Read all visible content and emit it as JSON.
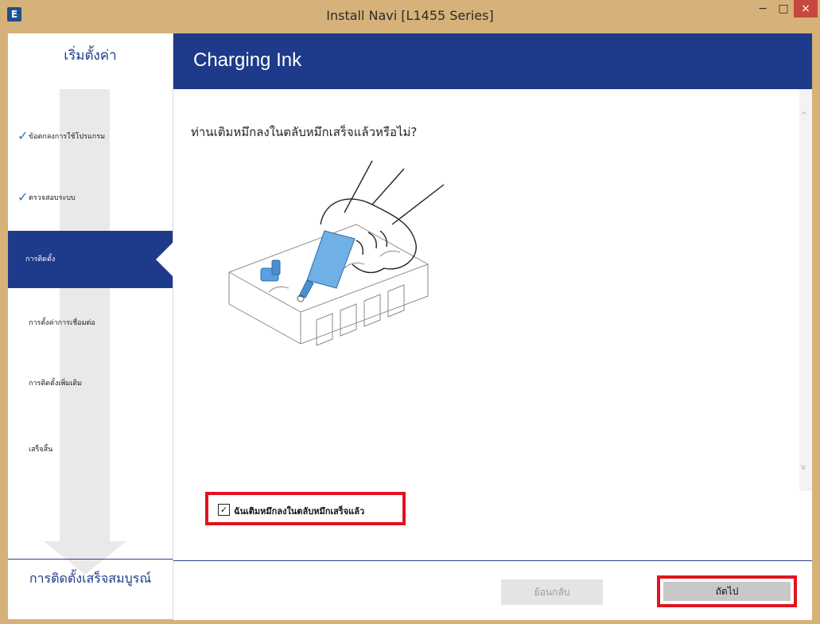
{
  "window": {
    "app_icon_letter": "E",
    "title": "Install Navi [L1455 Series]",
    "minimize_glyph": "−",
    "maximize_glyph": "□",
    "close_glyph": "×"
  },
  "sidebar": {
    "header": "เริ่มตั้งค่า",
    "steps": [
      {
        "label": "ข้อตกลงการใช้โปรแกรม",
        "state": "done",
        "check": "✓"
      },
      {
        "label": "ตรวจสอบระบบ",
        "state": "done",
        "check": "✓"
      },
      {
        "label": "การติดตั้ง",
        "state": "current"
      },
      {
        "label": "การตั้งค่าการเชื่อมต่อ",
        "state": "pending"
      },
      {
        "label": "การติดตั้งเพิ่มเติม",
        "state": "pending"
      },
      {
        "label": "เสร็จสิ้น",
        "state": "pending"
      }
    ],
    "footer": "การติดตั้งเสร็จสมบูรณ์"
  },
  "main": {
    "page_title": "Charging Ink",
    "question": "ท่านเติมหมึกลงในตลับหมึกเสร็จแล้วหรือไม่?",
    "illustration": "ink-bottle-filling-illustration",
    "confirm_checkbox": {
      "checked": true,
      "check_glyph": "✓",
      "label": "ฉันเติมหมึกลงในตลับหมึกเสร็จแล้ว"
    },
    "scroll_up_glyph": "^",
    "scroll_down_glyph": "v"
  },
  "footer": {
    "back_label": "ย้อนกลับ",
    "next_label": "ถัดไป"
  },
  "colors": {
    "title_bar": "#d6b27a",
    "header_blue": "#1e3a8a",
    "highlight_red": "#e0141e",
    "ink_blue": "#6fb0e6"
  }
}
